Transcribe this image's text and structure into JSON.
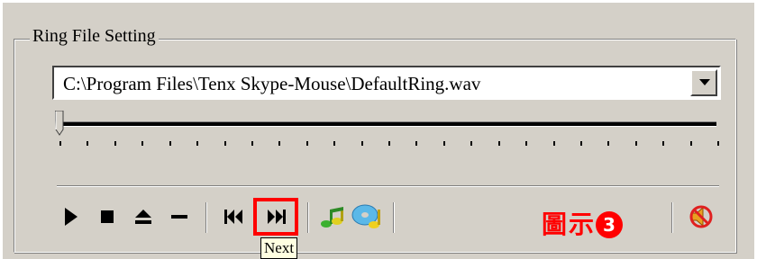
{
  "group": {
    "title": "Ring File Setting"
  },
  "combo": {
    "value": "C:\\Program Files\\Tenx Skype-Mouse\\DefaultRing.wav"
  },
  "slider": {
    "position": 0
  },
  "toolbar": {
    "buttons": [
      {
        "name": "play-button",
        "icon": "play"
      },
      {
        "name": "stop-button",
        "icon": "stop"
      },
      {
        "name": "eject-button",
        "icon": "eject"
      },
      {
        "name": "minus-button",
        "icon": "minus"
      },
      {
        "name": "previous-button",
        "icon": "previous"
      },
      {
        "name": "next-button",
        "icon": "next"
      },
      {
        "name": "music-notes-button",
        "icon": "music-notes"
      },
      {
        "name": "music-cd-button",
        "icon": "music-cd"
      },
      {
        "name": "mute-speaker-button",
        "icon": "mute-speaker"
      }
    ]
  },
  "tooltip": {
    "text": "Next"
  },
  "caption": {
    "text": "圖示",
    "number": "3"
  },
  "colors": {
    "highlight": "#ff0000",
    "face": "#d4d0c8"
  }
}
